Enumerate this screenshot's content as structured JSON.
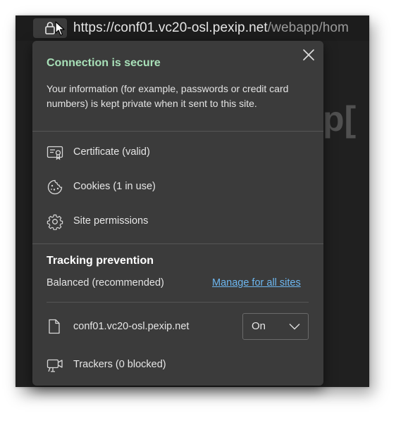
{
  "address_bar": {
    "url_host": "https://conf01.vc20-osl.pexip.net",
    "url_path": "/webapp/hom",
    "icons": [
      "lock-icon",
      "mouse-cursor-icon"
    ]
  },
  "background_page": {
    "partial_text": "p["
  },
  "flyout": {
    "status_title": "Connection is secure",
    "status_color": "#a8e0b8",
    "description": "Your information (for example, passwords or credit card numbers) is kept private when it sent to this site.",
    "close_icon": "close-icon",
    "items": [
      {
        "label": "Certificate (valid)",
        "icon": "certificate-icon"
      },
      {
        "label": "Cookies (1 in use)",
        "icon": "cookie-icon"
      },
      {
        "label": "Site permissions",
        "icon": "gear-icon"
      }
    ],
    "tracking": {
      "title": "Tracking prevention",
      "level": "Balanced (recommended)",
      "manage_link": "Manage for all sites",
      "link_color": "#6db7f0",
      "site": "conf01.vc20-osl.pexip.net",
      "site_icon": "document-icon",
      "toggle_value": "On",
      "trackers": "Trackers (0 blocked)",
      "trackers_icon": "tracker-camera-icon"
    }
  }
}
